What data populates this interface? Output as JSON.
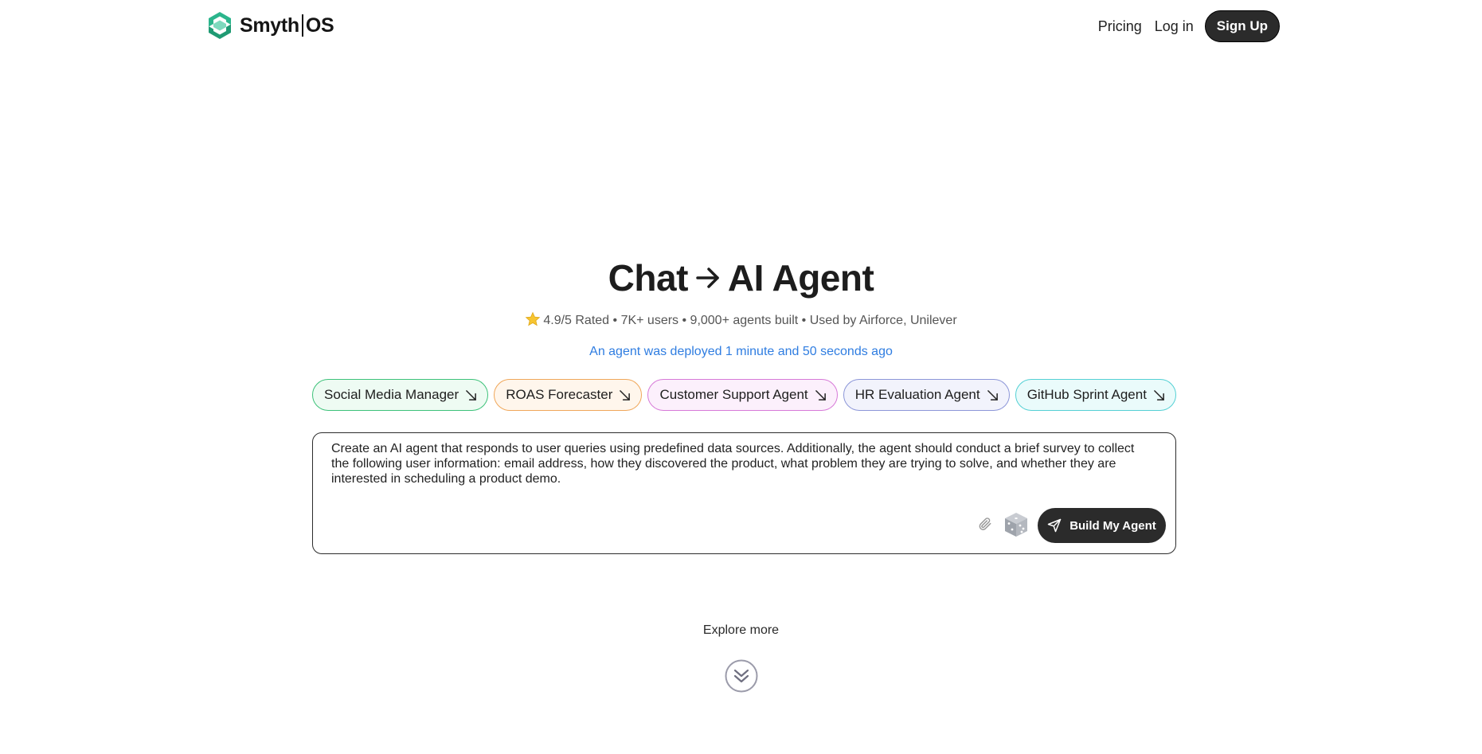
{
  "brand": {
    "name_left": "Smyth",
    "name_right": "OS",
    "logo_color": "#2bb58c"
  },
  "nav": {
    "pricing": "Pricing",
    "login": "Log in",
    "signup": "Sign Up"
  },
  "hero": {
    "title_left": "Chat",
    "title_right": "AI Agent",
    "arrow_icon": "arrow-right-icon",
    "stats": "4.9/5 Rated • 7K+ users • 9,000+ agents built • Used by Airforce, Unilever",
    "star_icon": "star-icon",
    "deployed": "An agent was deployed 1 minute and 50 seconds ago"
  },
  "chips": [
    {
      "label": "Social Media Manager",
      "border": "#3ec27a",
      "bg": "#eefbf3"
    },
    {
      "label": "ROAS Forecaster",
      "border": "#f0a75a",
      "bg": "#fff6ec"
    },
    {
      "label": "Customer Support Agent",
      "border": "#d77ad8",
      "bg": "#fcf0fc"
    },
    {
      "label": "HR Evaluation Agent",
      "border": "#8c96d8",
      "bg": "#f2f3fc"
    },
    {
      "label": "GitHub Sprint Agent",
      "border": "#54d0d4",
      "bg": "#eafbfb"
    }
  ],
  "prompt": {
    "value": "Create an AI agent that responds to user queries using predefined data sources. Additionally, the agent should conduct a brief survey to collect the following user information: email address, how they discovered the product, what problem they are trying to solve, and whether they are interested in scheduling a product demo.",
    "build_label": "Build My Agent"
  },
  "explore": {
    "label": "Explore more"
  }
}
